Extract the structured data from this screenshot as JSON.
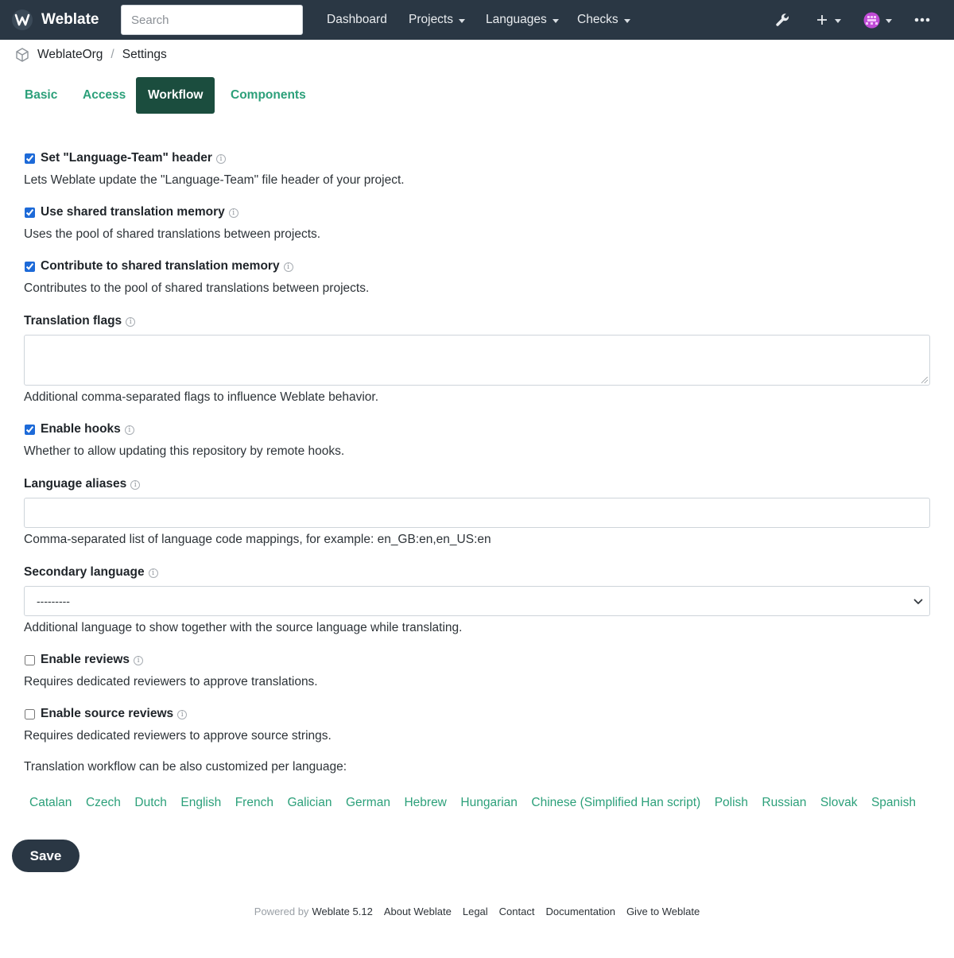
{
  "navbar": {
    "brand": "Weblate",
    "search_placeholder": "Search",
    "items": [
      {
        "label": "Dashboard"
      },
      {
        "label": "Projects"
      },
      {
        "label": "Languages"
      },
      {
        "label": "Checks"
      }
    ],
    "icons": [
      "wrench-icon",
      "plus-icon",
      "avatar",
      "more-icon"
    ],
    "colors": {
      "background": "#2a3744",
      "accent": "#2ca07a"
    }
  },
  "breadcrumb": {
    "project": "WeblateOrg",
    "current": "Settings"
  },
  "tabs": [
    {
      "label": "Basic",
      "active": false
    },
    {
      "label": "Access",
      "active": false
    },
    {
      "label": "Workflow",
      "active": true
    },
    {
      "label": "Components",
      "active": false
    }
  ],
  "form": {
    "language_team_header": {
      "label": "Set \"Language-Team\" header",
      "checked": true,
      "help": "Lets Weblate update the \"Language-Team\" file header of your project."
    },
    "use_shared_tm": {
      "label": "Use shared translation memory",
      "checked": true,
      "help": "Uses the pool of shared translations between projects."
    },
    "contribute_shared_tm": {
      "label": "Contribute to shared translation memory",
      "checked": true,
      "help": "Contributes to the pool of shared translations between projects."
    },
    "translation_flags": {
      "label": "Translation flags",
      "value": "",
      "help": "Additional comma-separated flags to influence Weblate behavior."
    },
    "enable_hooks": {
      "label": "Enable hooks",
      "checked": true,
      "help": "Whether to allow updating this repository by remote hooks."
    },
    "language_aliases": {
      "label": "Language aliases",
      "value": "",
      "help": "Comma-separated list of language code mappings, for example: en_GB:en,en_US:en"
    },
    "secondary_language": {
      "label": "Secondary language",
      "selected": "---------",
      "help": "Additional language to show together with the source language while translating."
    },
    "enable_reviews": {
      "label": "Enable reviews",
      "checked": false,
      "help": "Requires dedicated reviewers to approve translations."
    },
    "enable_source_reviews": {
      "label": "Enable source reviews",
      "checked": false,
      "help": "Requires dedicated reviewers to approve source strings."
    },
    "per_language_note": "Translation workflow can be also customized per language:",
    "languages": [
      "Catalan",
      "Czech",
      "Dutch",
      "English",
      "French",
      "Galician",
      "German",
      "Hebrew",
      "Hungarian",
      "Chinese (Simplified Han script)",
      "Polish",
      "Russian",
      "Slovak",
      "Spanish"
    ],
    "save_label": "Save"
  },
  "footer": {
    "powered_by": "Powered by",
    "version": "Weblate 5.12",
    "links": [
      "About Weblate",
      "Legal",
      "Contact",
      "Documentation",
      "Give to Weblate"
    ]
  }
}
